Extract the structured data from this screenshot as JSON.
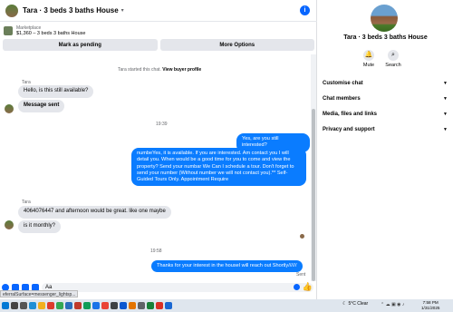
{
  "header": {
    "title": "Tara · 3 beds 3 baths House"
  },
  "listing": {
    "category": "Marketplace",
    "info": "$1,360 – 3 beds 3 baths House"
  },
  "actions": {
    "pending_label": "Mark as pending",
    "more_label": "More Options"
  },
  "conversation": {
    "started_text": "Tara started this chat.",
    "view_profile": "View buyer profile",
    "sender_name": "Tara",
    "msg1": "Hello, is this still available?",
    "msg_sent": "Message sent",
    "time1": "19:39",
    "out1": "Yes, are you still interested?",
    "out2": "numbeYes, it is available. If you are interested.  Am contact you I will detail you. When would be a good time for you to come and view the property? Send your numbar We Can I schedule a tour.  Don't forget to send your number (Without number we will not contact you).** Self-Guided Tours Only. Appointment Require",
    "sender_name2": "Tara",
    "msg2": "4064076447 and afternoon would be great. like one  maybe",
    "msg3": "is it monthly?",
    "time2": "19:58",
    "out3": "Thanks for your interest in the housel will reach out Shortly//////",
    "sent_status": "Sent"
  },
  "composer": {
    "value": "Aa"
  },
  "status_url": "eferralSurface=messenger_lightsp...",
  "panel": {
    "title": "Tara · 3 beds 3 baths House",
    "mute_label": "Mute",
    "search_label": "Search",
    "sections": [
      "Customise chat",
      "Chat members",
      "Media, files and links",
      "Privacy and support"
    ]
  },
  "taskbar": {
    "weather": "5°C  Clear",
    "time": "7:58 PM",
    "date": "1/31/2025"
  },
  "colors": {
    "accent": "#0866ff",
    "bubble_out": "#0a7cff",
    "bubble_in": "#e4e6eb"
  }
}
